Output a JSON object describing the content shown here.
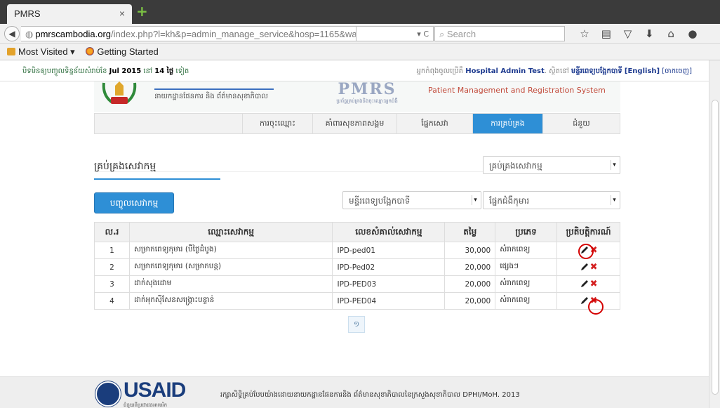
{
  "browser": {
    "tab_title": "PMRS",
    "tab_close": "×",
    "new_tab": "+",
    "url_prefix": "",
    "url_domain": "pmrscambodia.org",
    "url_path": "/index.php?l=kh&p=admin_manage_service&hosp=1165&ward=11",
    "reload": "▾ C",
    "search_placeholder": "Search",
    "bookmarks": [
      "Most Visited ▾",
      "Getting Started"
    ]
  },
  "topstrip": {
    "left_pre": "បិទមិនឲ្យបញ្ចូលទិន្នន័យសំរាប់ខែ",
    "month": "Jul 2015",
    "left_mid": "នៅ",
    "days": "14 ថ្ងៃ",
    "left_post": "ទៀត",
    "right_pre": "អ្នកកំពុងចូលប្រើគឺ",
    "user": "Hospital Admin Test",
    "right_mid": ". ស្ថិតនៅ",
    "hospital": "មន្ទីរពេទ្យបង្អែកបាទី",
    "lang": "[English]",
    "logout": "[ចាកចេញ]"
  },
  "header": {
    "ministry_name": "នាយកដ្ឋានផែនការ និង ព័ត៌មានសុខាភិបាល",
    "logo_big": "PMRS",
    "logo_small": "ប្រព័ន្ធគ្រប់គ្រងនិងចុះឈ្មោះអ្នកជំងឺ",
    "system_name": "Patient Management and Registration System"
  },
  "menu": {
    "items": [
      "ការចុះឈ្មោះ",
      "គាំពារសុខភាពសង្គម",
      "ផ្នែកសេវា",
      "ការគ្រប់គ្រង",
      "ជំនួយ"
    ]
  },
  "main": {
    "title": "គ្រប់គ្រងសេវាកម្ម",
    "manage_select": "គ្រប់គ្រងសេវាកម្ម",
    "add_button": "បញ្ចូលសេវាកម្ម",
    "hospital_select": "មន្ទីរពេទ្យបង្អែកបាទី",
    "ward_select": "ផ្នែកជំងឺកុមារ"
  },
  "table": {
    "headers": [
      "ល.រ",
      "ឈ្មោះសេវាកម្ម",
      "លេខសំគាល់សេវាកម្ម",
      "តម្លៃ",
      "ប្រភេទ",
      "ប្រតិបត្តិការណ៍"
    ],
    "rows": [
      {
        "no": "1",
        "name": "សម្រាកពេទ្យកុមារ (បីថ្ងៃដំបូង)",
        "code": "IPD-ped01",
        "price": "30,000",
        "type": "សំរាកពេទ្យ"
      },
      {
        "no": "2",
        "name": "សម្រាកពេទ្យកុមារ (សម្រាកបន្ត)",
        "code": "IPD-Ped02",
        "price": "20,000",
        "type": "ផ្សេងៗ"
      },
      {
        "no": "3",
        "name": "ដាក់សុងដោម",
        "code": "IPD-PED03",
        "price": "20,000",
        "type": "សំរាកពេទ្យ"
      },
      {
        "no": "4",
        "name": "ដាក់អុកស៊ីសែនសង្គ្រោះបន្ទាន់",
        "code": "IPD-PED04",
        "price": "20,000",
        "type": "សំរាកពេទ្យ"
      }
    ]
  },
  "pagination": {
    "current": "១"
  },
  "footer": {
    "logo": "USAID",
    "logo_sub": "ជំនួយពីប្រជាជនអាមេរិក",
    "copyright": "រក្សាសិទ្ធិគ្រប់បែបយ៉ាងដោយនាយកដ្ឋានផែនការនិង ព័ត៌មានសុខាភិបាលនៃក្រសួងសុខាភិបាល DPHI/MoH. 2013"
  },
  "colors": {
    "accent": "#2e8fd6",
    "danger": "#d42020",
    "brand_blue": "#1a3d7c"
  }
}
